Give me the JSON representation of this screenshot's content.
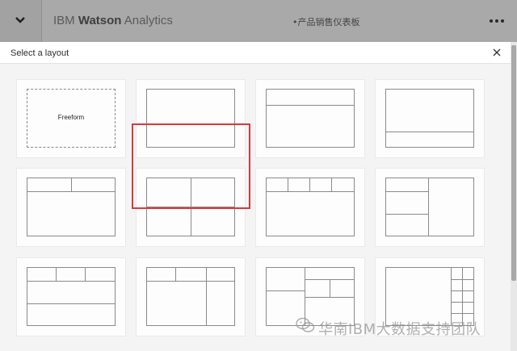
{
  "app": {
    "brand_prefix": "IBM",
    "brand_bold": "Watson",
    "brand_suffix": "Analytics",
    "dashboard_title": "•产品销售仪表板"
  },
  "icons": {
    "collapse": "chevron-down-icon",
    "more": "more-horizontal-icon",
    "close": "close-icon",
    "watermark": "wechat-icon"
  },
  "dialog": {
    "title": "Select a layout",
    "selected_layout_index": 5,
    "layouts": [
      {
        "name": "layout-freeform",
        "label": "Freeform"
      },
      {
        "name": "layout-single-panel"
      },
      {
        "name": "layout-header-body"
      },
      {
        "name": "layout-body-footer"
      },
      {
        "name": "layout-two-header-body"
      },
      {
        "name": "layout-four-quadrants"
      },
      {
        "name": "layout-four-header-body"
      },
      {
        "name": "layout-left-split-right"
      },
      {
        "name": "layout-three-header-two-rows"
      },
      {
        "name": "layout-three-header-right-column"
      },
      {
        "name": "layout-mixed-grid"
      },
      {
        "name": "layout-complex-grid"
      }
    ]
  },
  "watermark": {
    "text": "华南IBM大数据支持团队"
  },
  "colors": {
    "topbar": "#a9a9a9",
    "selection_border": "#d93a3a",
    "panel_line": "#8a8a8a"
  }
}
